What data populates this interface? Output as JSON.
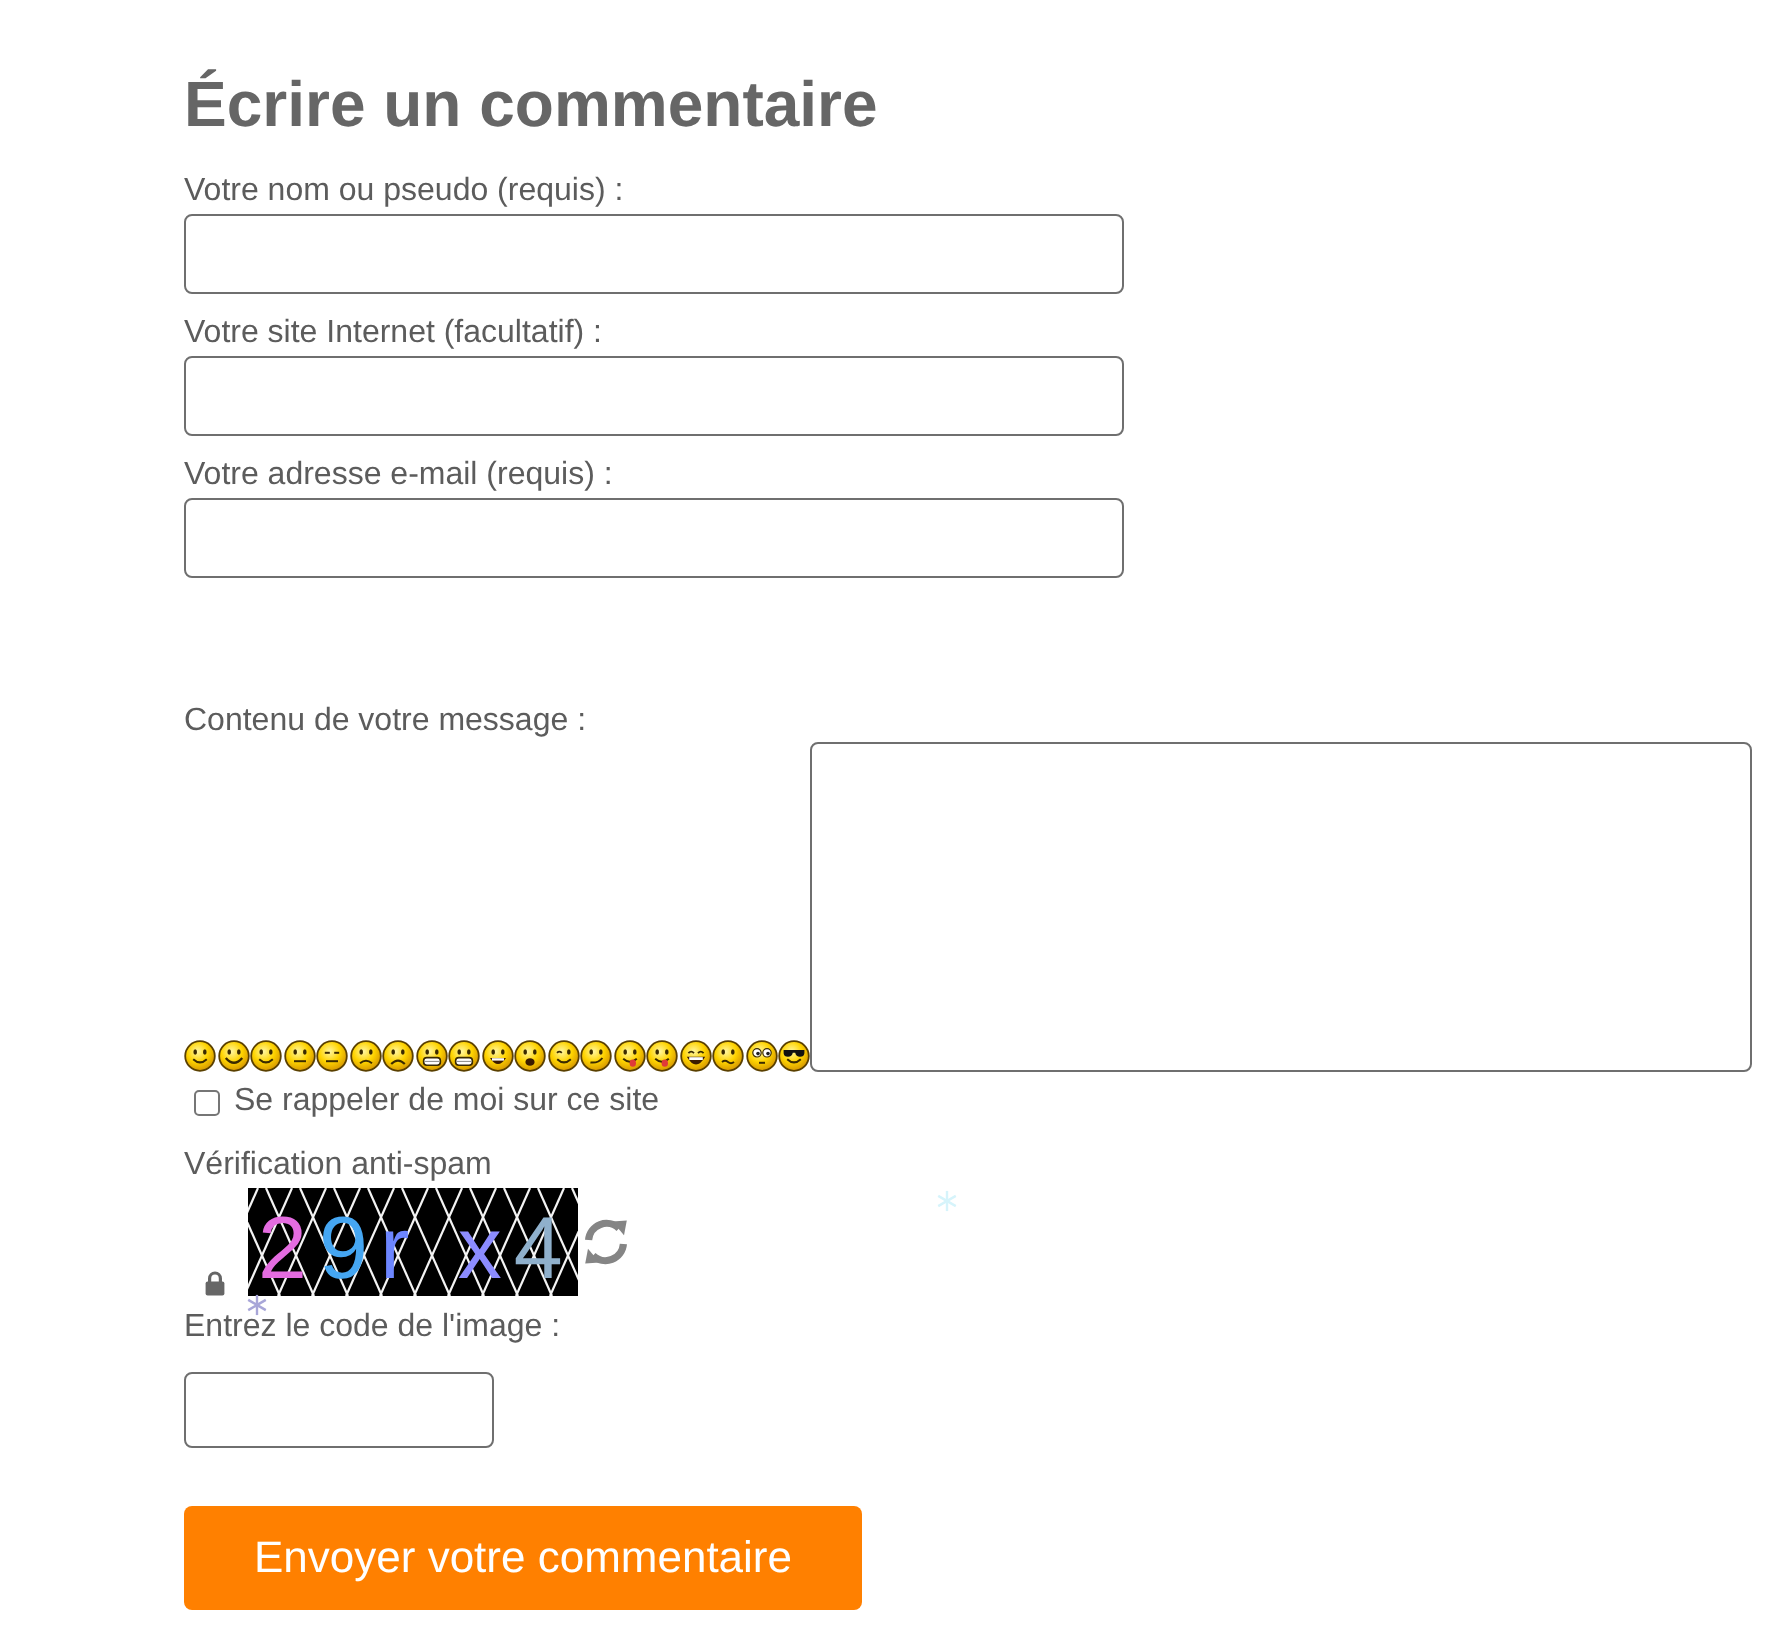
{
  "heading": "Écrire un commentaire",
  "fields": [
    {
      "label": "Votre nom ou pseudo (requis) :"
    },
    {
      "label": "Votre site Internet (facultatif) :"
    },
    {
      "label": "Votre adresse e-mail (requis) :"
    }
  ],
  "message": {
    "label": "Contenu de votre message :",
    "smileys": [
      {
        "kind": "smile"
      },
      {
        "kind": "grin"
      },
      {
        "kind": "smile"
      },
      {
        "kind": "neutral"
      },
      {
        "kind": "flat"
      },
      {
        "kind": "sad"
      },
      {
        "kind": "frown"
      },
      {
        "kind": "teeth"
      },
      {
        "kind": "teeth"
      },
      {
        "kind": "laugh"
      },
      {
        "kind": "surprise"
      },
      {
        "kind": "wink"
      },
      {
        "kind": "smirk"
      },
      {
        "kind": "tongue"
      },
      {
        "kind": "tongue"
      },
      {
        "kind": "lol"
      },
      {
        "kind": "worried"
      },
      {
        "kind": "eyes"
      },
      {
        "kind": "cool"
      }
    ]
  },
  "remember": {
    "label": "Se rappeler de moi sur ce site",
    "checked": false
  },
  "captcha": {
    "title": "Vérification anti-spam",
    "image_text": "29r x4",
    "code_label": "Entrez le code de l'image :"
  },
  "submit": "Envoyer votre commentaire"
}
